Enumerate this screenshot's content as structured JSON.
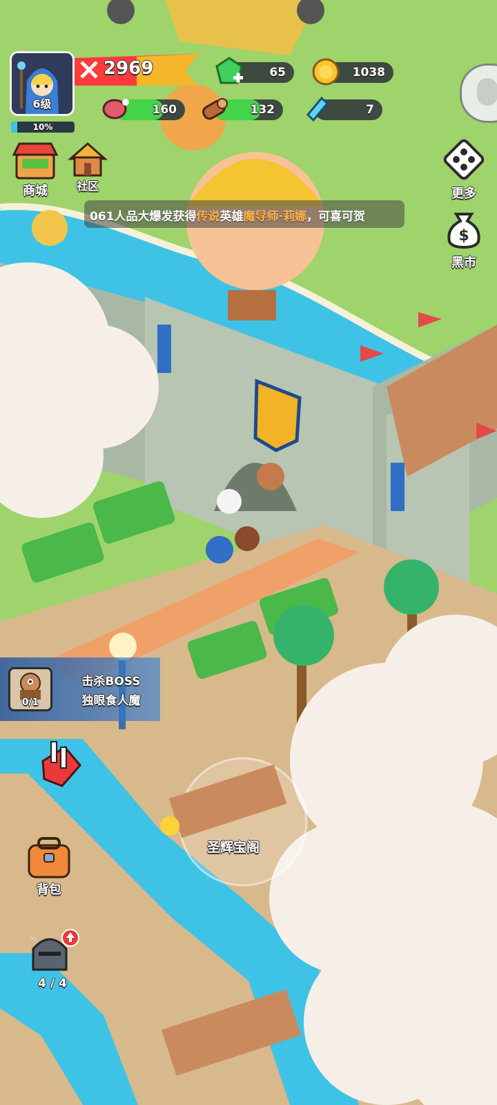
{
  "player": {
    "level_label": "6级",
    "exp_percent_label": "10%",
    "exp_fraction": 0.1,
    "power": "2969"
  },
  "resources": {
    "gems": "65",
    "gold": "1038",
    "meat": "160",
    "meat_fill": 0.7,
    "wood": "132",
    "wood_fill": 0.68,
    "crystal": "7",
    "crystal_fill": 0.0
  },
  "left_menu": {
    "shop_label": "商城",
    "community_label": "社区",
    "backpack_label": "背包",
    "heroes_count": "4 / 4"
  },
  "right_menu": {
    "more_label": "更多",
    "black_market_label": "黑市"
  },
  "ticker": {
    "part1": "061人品大爆发获得",
    "part2": "传说",
    "part3": "英雄",
    "part4": "魔导师·莉娜",
    "part5": "，可喜可贺"
  },
  "quest": {
    "line1": "击杀BOSS",
    "line2": "独眼食人魔",
    "progress": "0/1"
  },
  "map_labels": {
    "building1": "圣辉宝阁"
  },
  "colors": {
    "grass": "#9fd36b",
    "water": "#3ec3e6",
    "stone": "#a9b8a4",
    "path": "#d8b98c",
    "hp_green": "#44d44a",
    "power_red": "#ff3b3b"
  }
}
